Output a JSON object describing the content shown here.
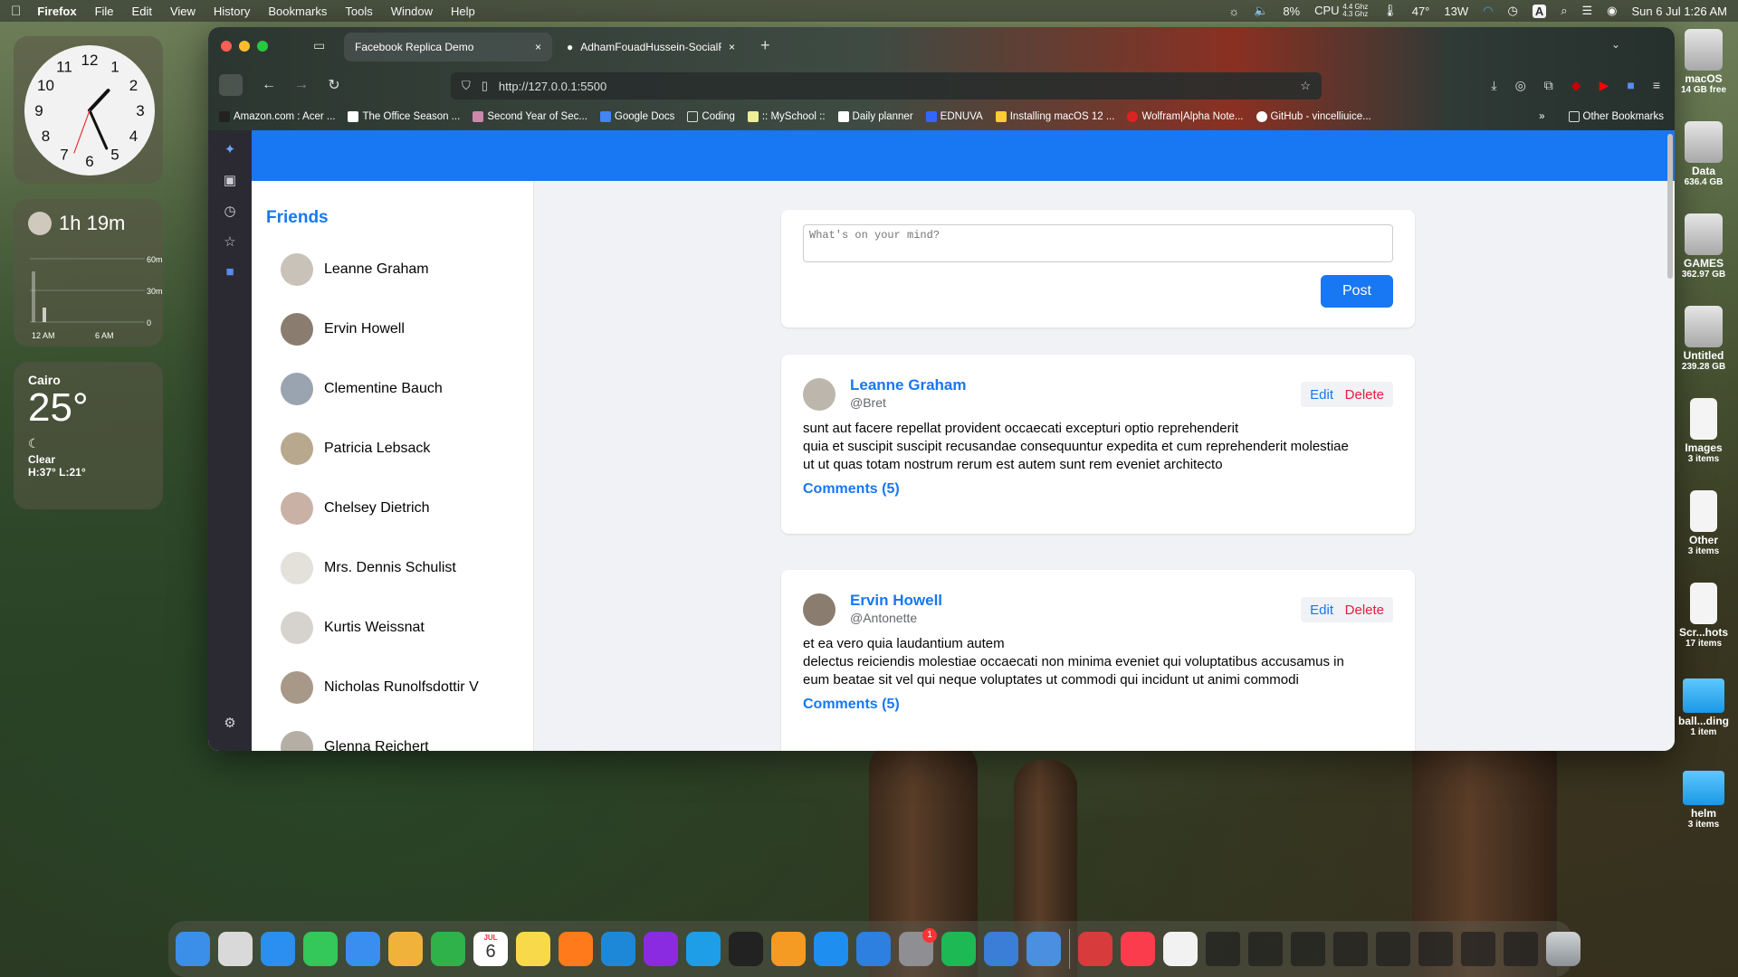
{
  "menubar": {
    "app": "Firefox",
    "items": [
      "File",
      "Edit",
      "View",
      "History",
      "Bookmarks",
      "Tools",
      "Window",
      "Help"
    ],
    "battery_pct": "8%",
    "cpu_label": "CPU",
    "cpu_freq_top": "4.4 Ghz",
    "cpu_freq_bottom": "4.3 Ghz",
    "temp": "47°",
    "power": "13W",
    "input_letter": "A",
    "datetime": "Sun 6 Jul 1:26 AM"
  },
  "widgets": {
    "clock_numbers": [
      "12",
      "1",
      "2",
      "3",
      "4",
      "5",
      "6",
      "7",
      "8",
      "9",
      "10",
      "11"
    ],
    "battery_time": "1h 19m",
    "battery_axis": [
      "60m",
      "30m",
      "0"
    ],
    "battery_time_labels": [
      "12 AM",
      "6 AM"
    ],
    "weather_city": "Cairo",
    "weather_temp": "25°",
    "weather_condition": "Clear",
    "weather_range": "H:37° L:21°"
  },
  "browser": {
    "tabs": [
      {
        "title": "Facebook Replica Demo",
        "close": "×"
      },
      {
        "title": "AdhamFouadHussein-SocialFee",
        "close": "×"
      }
    ],
    "new_tab": "+",
    "url": "http://127.0.0.1:5500",
    "bookmarks": [
      "Amazon.com : Acer ...",
      "The Office Season ...",
      "Second Year of Sec...",
      "Google Docs",
      "Coding",
      ":: MySchool ::",
      "Daily planner",
      "EDNUVA",
      "Installing macOS 12 ...",
      "Wolfram|Alpha Note...",
      "GitHub - vincelliuice..."
    ],
    "other_bookmarks": "Other Bookmarks",
    "overflow": "»"
  },
  "page": {
    "friends_title": "Friends",
    "friends": [
      "Leanne Graham",
      "Ervin Howell",
      "Clementine Bauch",
      "Patricia Lebsack",
      "Chelsey Dietrich",
      "Mrs. Dennis Schulist",
      "Kurtis Weissnat",
      "Nicholas Runolfsdottir V",
      "Glenna Reichert"
    ],
    "composer_placeholder": "What's on your mind?",
    "post_button": "Post",
    "posts": [
      {
        "name": "Leanne Graham",
        "username": "@Bret",
        "lines": [
          "sunt aut facere repellat provident occaecati excepturi optio reprehenderit",
          "quia et suscipit suscipit recusandae consequuntur expedita et cum reprehenderit molestiae",
          "ut ut quas totam nostrum rerum est autem sunt rem eveniet architecto"
        ],
        "comments": "Comments (5)",
        "edit": "Edit",
        "delete": "Delete"
      },
      {
        "name": "Ervin Howell",
        "username": "@Antonette",
        "lines": [
          "et ea vero quia laudantium autem",
          "delectus reiciendis molestiae occaecati non minima eveniet qui voluptatibus accusamus in",
          "eum beatae sit vel qui neque voluptates ut commodi qui incidunt ut animi commodi"
        ],
        "comments": "Comments (5)",
        "edit": "Edit",
        "delete": "Delete"
      }
    ]
  },
  "desktop_icons": [
    {
      "name": "macOS",
      "sub": "14 GB free",
      "kind": "disk"
    },
    {
      "name": "Data",
      "sub": "636.4 GB",
      "kind": "disk"
    },
    {
      "name": "GAMES",
      "sub": "362.97 GB",
      "kind": "disk"
    },
    {
      "name": "Untitled",
      "sub": "239.28 GB",
      "kind": "disk"
    },
    {
      "name": "Images",
      "sub": "3 items",
      "kind": "file"
    },
    {
      "name": "Other",
      "sub": "3 items",
      "kind": "file"
    },
    {
      "name": "Scr...hots",
      "sub": "17 items",
      "kind": "file"
    },
    {
      "name": "ball...ding",
      "sub": "1 item",
      "kind": "folder"
    },
    {
      "name": "helm",
      "sub": "3 items",
      "kind": "folder"
    }
  ],
  "dock": {
    "apps": [
      {
        "name": "finder",
        "color": "#3b8fe8"
      },
      {
        "name": "launchpad",
        "color": "#d9d9d9"
      },
      {
        "name": "safari",
        "color": "#2a8ff0"
      },
      {
        "name": "messages",
        "color": "#34c759"
      },
      {
        "name": "mail",
        "color": "#3a8ef0"
      },
      {
        "name": "photos",
        "color": "#f0b23a"
      },
      {
        "name": "facetime",
        "color": "#2fb24a"
      },
      {
        "name": "calendar",
        "color": "#ffffff"
      },
      {
        "name": "notes",
        "color": "#f8d94a"
      },
      {
        "name": "firefox",
        "color": "#ff7a1a"
      },
      {
        "name": "vscode",
        "color": "#1e88d8"
      },
      {
        "name": "phpstorm",
        "color": "#8a2be2"
      },
      {
        "name": "edge",
        "color": "#1f9ee8"
      },
      {
        "name": "terminal",
        "color": "#222222"
      },
      {
        "name": "sublime",
        "color": "#f59a23"
      },
      {
        "name": "appstore",
        "color": "#1f8ef1"
      },
      {
        "name": "keynote",
        "color": "#2d7fe0"
      },
      {
        "name": "system-settings",
        "color": "#8e8e93"
      },
      {
        "name": "spotify",
        "color": "#1db954"
      },
      {
        "name": "xcode",
        "color": "#3a7ed8"
      },
      {
        "name": "xcode-beta",
        "color": "#4a8fe0"
      },
      {
        "name": "parallels",
        "color": "#d83b3b"
      },
      {
        "name": "music",
        "color": "#fa3c4c"
      },
      {
        "name": "textedit",
        "color": "#f2f2f2"
      }
    ],
    "calendar_month": "JUL",
    "calendar_day": "6",
    "settings_badge": "1"
  }
}
